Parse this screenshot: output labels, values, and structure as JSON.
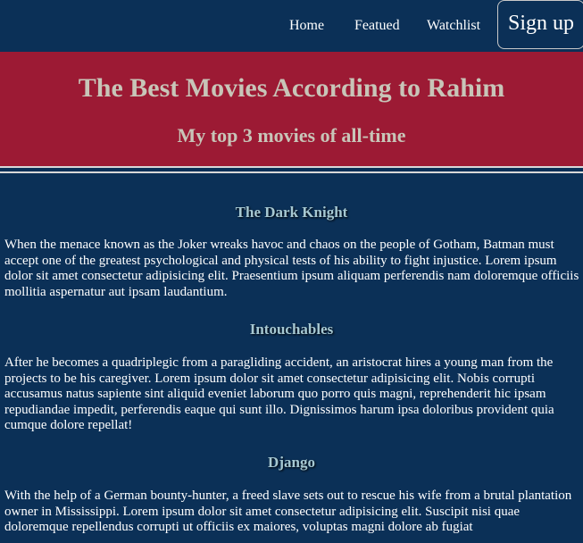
{
  "nav": {
    "links": [
      "Home",
      "Featued",
      "Watchlist"
    ],
    "signup_label": "Sign up"
  },
  "hero": {
    "title": "The Best Movies According to Rahim",
    "subtitle": "My top 3 movies of all-time"
  },
  "movies": [
    {
      "title": "The Dark Knight",
      "description": "When the menace known as the Joker wreaks havoc and chaos on the people of Gotham, Batman must accept one of the greatest psychological and physical tests of his ability to fight injustice. Lorem ipsum dolor sit amet consectetur adipisicing elit. Praesentium ipsum aliquam perferendis nam doloremque officiis mollitia aspernatur aut ipsam laudantium."
    },
    {
      "title": "Intouchables",
      "description": "After he becomes a quadriplegic from a paragliding accident, an aristocrat hires a young man from the projects to be his caregiver. Lorem ipsum dolor sit amet consectetur adipisicing elit. Nobis corrupti accusamus natus sapiente sint aliquid eveniet laborum quo porro quis magni, reprehenderit hic ipsam repudiandae impedit, perferendis eaque qui sunt illo. Dignissimos harum ipsa doloribus provident quia cumque dolore repellat!"
    },
    {
      "title": "Django",
      "description": "With the help of a German bounty-hunter, a freed slave sets out to rescue his wife from a brutal plantation owner in Mississippi. Lorem ipsum dolor sit amet consectetur adipisicing elit. Suscipit nisi quae doloremque repellendus corrupti ut officiis ex maiores, voluptas magni dolore ab fugiat"
    }
  ],
  "colors": {
    "background": "#0b3057",
    "hero_background": "#9c1a34",
    "hero_text": "#c8c5b8",
    "movie_title": "#a6c8d2",
    "body_text": "#ffffff"
  }
}
